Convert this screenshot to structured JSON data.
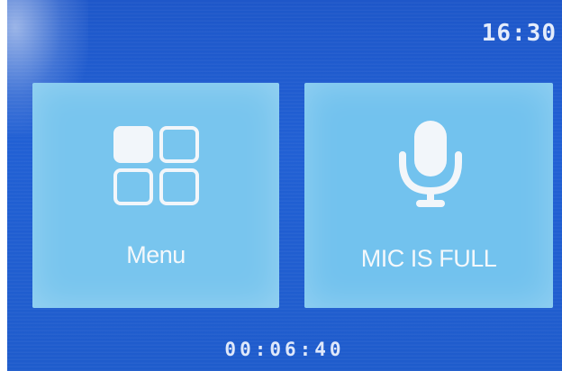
{
  "status_bar": {
    "time": "16:30"
  },
  "tiles": [
    {
      "label": "Menu",
      "icon": "menu-grid-icon"
    },
    {
      "label": "MIC IS FULL",
      "icon": "microphone-icon"
    }
  ],
  "footer": {
    "timer": "00:06:40"
  },
  "colors": {
    "background": "#1f5ccc",
    "tile": "#78c5ee",
    "text": "#f4f8fb"
  }
}
